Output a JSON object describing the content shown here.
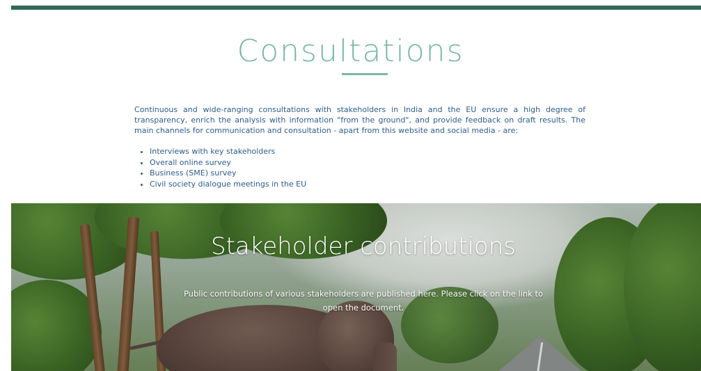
{
  "consultations": {
    "title": "Consultations",
    "intro": "Continuous and wide-ranging consultations with stakeholders in India and the EU ensure a high degree of transparency, enrich the analysis with information \"from the ground\", and provide feedback on draft results. The main channels for communication and consultation - apart from this website and social media - are:",
    "channels": [
      "Interviews with key stakeholders",
      "Overall online survey",
      "Business (SME) survey",
      "Civil society dialogue meetings in the EU"
    ]
  },
  "stakeholder_contributions": {
    "title": "Stakeholder contributions",
    "description": "Public contributions of various stakeholders are published here. Please click on the link to open the document."
  },
  "colors": {
    "accent": "#7ab8a5",
    "top_bar": "#2e6b55",
    "body_text": "#2c5d8a"
  }
}
